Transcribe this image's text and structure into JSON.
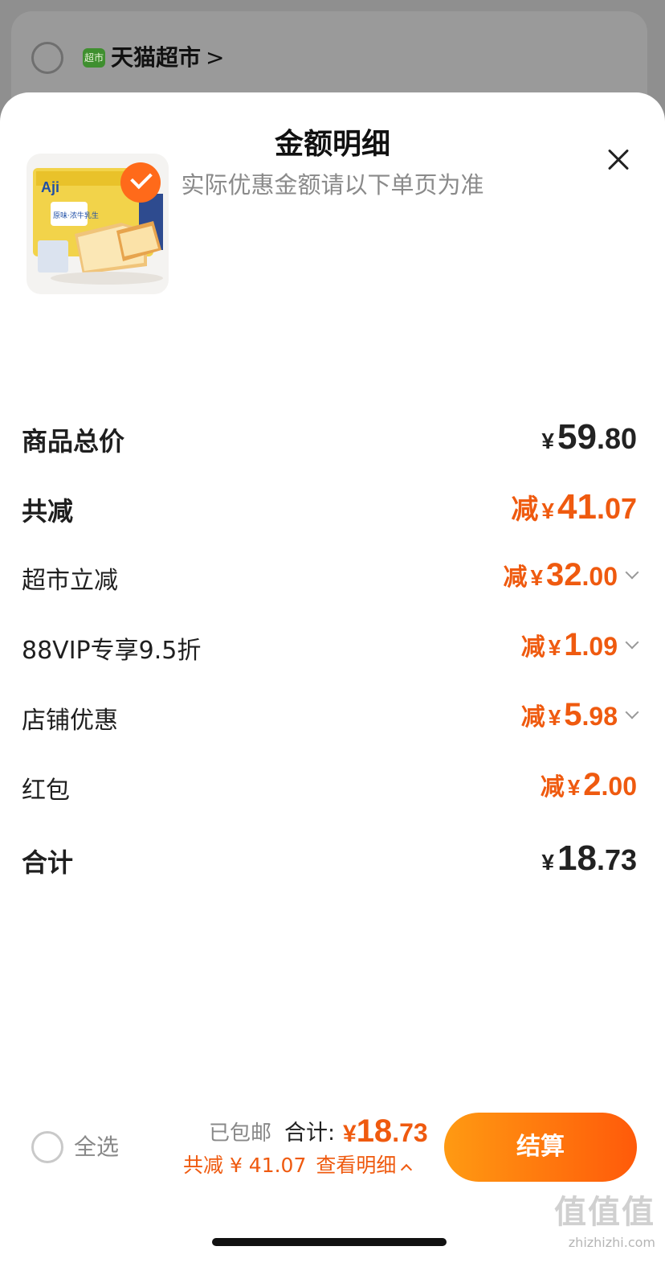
{
  "background": {
    "store_name": "天猫超市",
    "store_icon_label": "超市",
    "store_chevron": ">"
  },
  "sheet": {
    "title": "金额明细",
    "subtitle": "实际优惠金额请以下单页为准",
    "close_icon": "close-icon"
  },
  "product": {
    "thumbnail_brand": "Aji",
    "thumbnail_pack_text": "原味·浓牛乳生",
    "selected": true
  },
  "breakdown": [
    {
      "label": "商品总价",
      "prefix": "",
      "yen": "¥",
      "int": "59",
      "dec": ".80",
      "style": "total",
      "chevron": false
    },
    {
      "label": "共减",
      "prefix": "减",
      "yen": "¥",
      "int": "41",
      "dec": ".07",
      "style": "saving-big",
      "chevron": false
    },
    {
      "label": "超市立减",
      "prefix": "减",
      "yen": "¥",
      "int": "32",
      "dec": ".00",
      "style": "saving",
      "chevron": true
    },
    {
      "label": "88VIP专享9.5折",
      "prefix": "减",
      "yen": "¥",
      "int": "1",
      "dec": ".09",
      "style": "saving",
      "chevron": true
    },
    {
      "label": "店铺优惠",
      "prefix": "减",
      "yen": "¥",
      "int": "5",
      "dec": ".98",
      "style": "saving",
      "chevron": true
    },
    {
      "label": "红包",
      "prefix": "减",
      "yen": "¥",
      "int": "2",
      "dec": ".00",
      "style": "saving",
      "chevron": false
    },
    {
      "label": "合计",
      "prefix": "",
      "yen": "¥",
      "int": "18",
      "dec": ".73",
      "style": "grand",
      "chevron": false
    }
  ],
  "bottom_bar": {
    "select_all": "全选",
    "shipping": "已包邮",
    "total_label": "合计:",
    "total_yen": "¥",
    "total_int": "18",
    "total_dec": ".73",
    "saving_text": "共减 ¥ 41.07",
    "detail_link": "查看明细",
    "checkout_label": "结算"
  },
  "watermark": {
    "glyphs": "值值值",
    "url": "zhizhizhi.com"
  },
  "colors": {
    "accent": "#ef5a0f",
    "checkout_gradient_start": "#ff9a12",
    "checkout_gradient_end": "#ff5a0a"
  }
}
